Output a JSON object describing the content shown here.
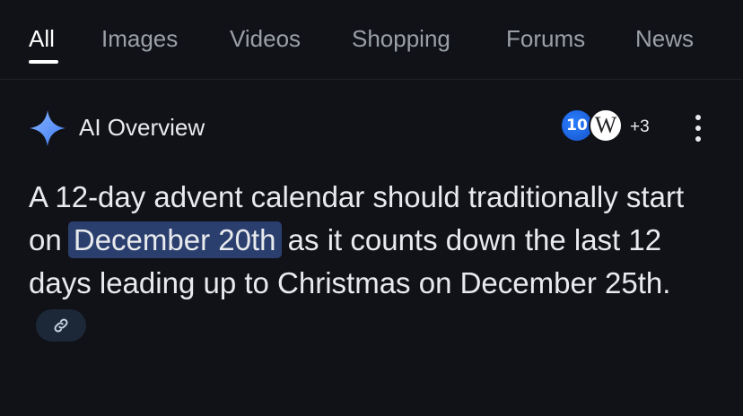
{
  "tabs": [
    {
      "label": "All",
      "active": true
    },
    {
      "label": "Images",
      "active": false
    },
    {
      "label": "Videos",
      "active": false
    },
    {
      "label": "Shopping",
      "active": false
    },
    {
      "label": "Forums",
      "active": false
    },
    {
      "label": "News",
      "active": false
    }
  ],
  "ai_overview": {
    "icon": "sparkle-icon",
    "title": "AI Overview",
    "sources": {
      "avatars": [
        {
          "label": "10",
          "icon": "nbc-10-logo"
        },
        {
          "label": "W",
          "icon": "wikipedia-logo"
        }
      ],
      "more_count": "+3"
    },
    "menu_icon": "more-vert-icon",
    "answer": {
      "before": "A 12-day advent calendar should traditionally start on ",
      "highlight": "December 20th",
      "after": " as it counts down the last 12 days leading up to Christmas on December 25th.",
      "link_icon": "link-icon"
    }
  },
  "colors": {
    "background": "#101218",
    "highlight": "#2a3f6e",
    "sparkle": "#4a8df8",
    "muted_text": "#9aa0a6",
    "text": "#e8eaed"
  }
}
